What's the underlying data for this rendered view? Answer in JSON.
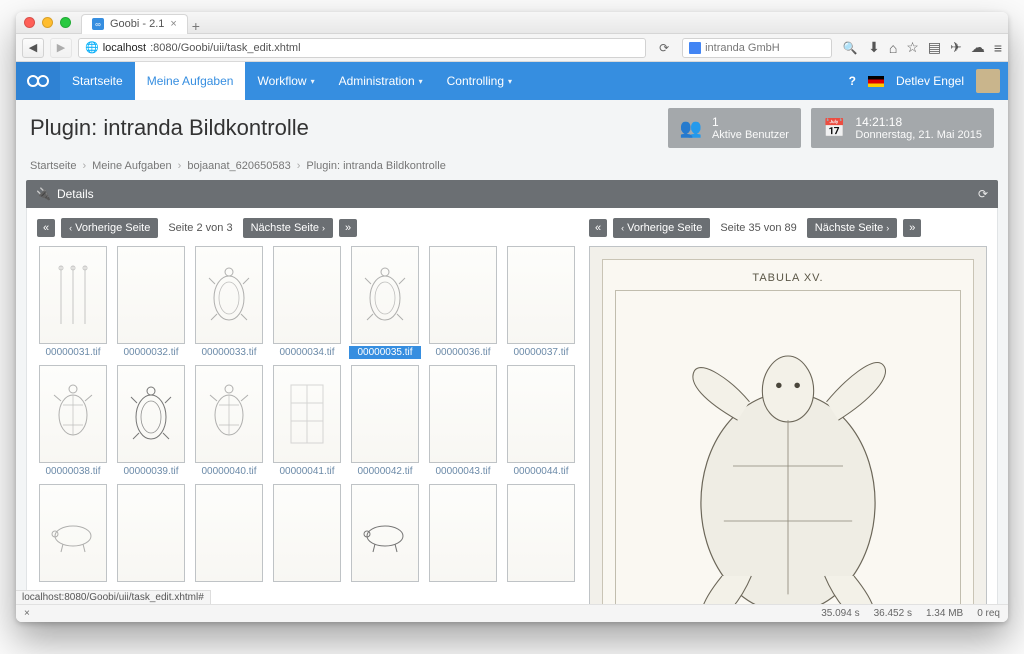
{
  "browser": {
    "tab_title": "Goobi - 2.1",
    "url_host": "localhost",
    "url_rest": ":8080/Goobi/uii/task_edit.xhtml",
    "search_placeholder": "intranda GmbH",
    "status_url": "localhost:8080/Goobi/uii/task_edit.xhtml#"
  },
  "topnav": {
    "items": [
      {
        "label": "Startseite"
      },
      {
        "label": "Meine Aufgaben"
      },
      {
        "label": "Workflow"
      },
      {
        "label": "Administration"
      },
      {
        "label": "Controlling"
      }
    ],
    "active_index": 1,
    "username": "Detlev Engel"
  },
  "page_title": "Plugin: intranda Bildkontrolle",
  "info_cards": {
    "users": {
      "line1": "1",
      "line2": "Aktive Benutzer"
    },
    "datetime": {
      "line1": "14:21:18",
      "line2": "Donnerstag, 21. Mai 2015"
    }
  },
  "breadcrumb": [
    "Startseite",
    "Meine Aufgaben",
    "bojaanat_620650583",
    "Plugin: intranda Bildkontrolle"
  ],
  "details_label": "Details",
  "pager_left": {
    "prev": "Vorherige Seite",
    "info": "Seite 2 von 3",
    "next": "Nächste Seite"
  },
  "pager_right": {
    "prev": "Vorherige Seite",
    "info": "Seite 35 von 89",
    "next": "Nächste Seite"
  },
  "thumbnails": [
    {
      "file": "00000031.tif",
      "variant": "bones"
    },
    {
      "file": "00000032.tif",
      "variant": "blank"
    },
    {
      "file": "00000033.tif",
      "variant": "top"
    },
    {
      "file": "00000034.tif",
      "variant": "blank"
    },
    {
      "file": "00000035.tif",
      "variant": "top",
      "selected": true
    },
    {
      "file": "00000036.tif",
      "variant": "blank"
    },
    {
      "file": "00000037.tif",
      "variant": "blank"
    },
    {
      "file": "00000038.tif",
      "variant": "bottom"
    },
    {
      "file": "00000039.tif",
      "variant": "top-dark"
    },
    {
      "file": "00000040.tif",
      "variant": "bottom"
    },
    {
      "file": "00000041.tif",
      "variant": "diagram"
    },
    {
      "file": "00000042.tif",
      "variant": "blank"
    },
    {
      "file": "00000043.tif",
      "variant": "blank"
    },
    {
      "file": "00000044.tif",
      "variant": "blank"
    },
    {
      "file": "",
      "variant": "side"
    },
    {
      "file": "",
      "variant": "blank"
    },
    {
      "file": "",
      "variant": "blank"
    },
    {
      "file": "",
      "variant": "blank"
    },
    {
      "file": "",
      "variant": "side-dark"
    },
    {
      "file": "",
      "variant": "blank"
    },
    {
      "file": "",
      "variant": "blank"
    }
  ],
  "preview": {
    "plate_title": "TABULA XV."
  },
  "footer": {
    "t1": "35.094 s",
    "t2": "36.452 s",
    "mem": "1.34 MB",
    "req": "0 req"
  }
}
